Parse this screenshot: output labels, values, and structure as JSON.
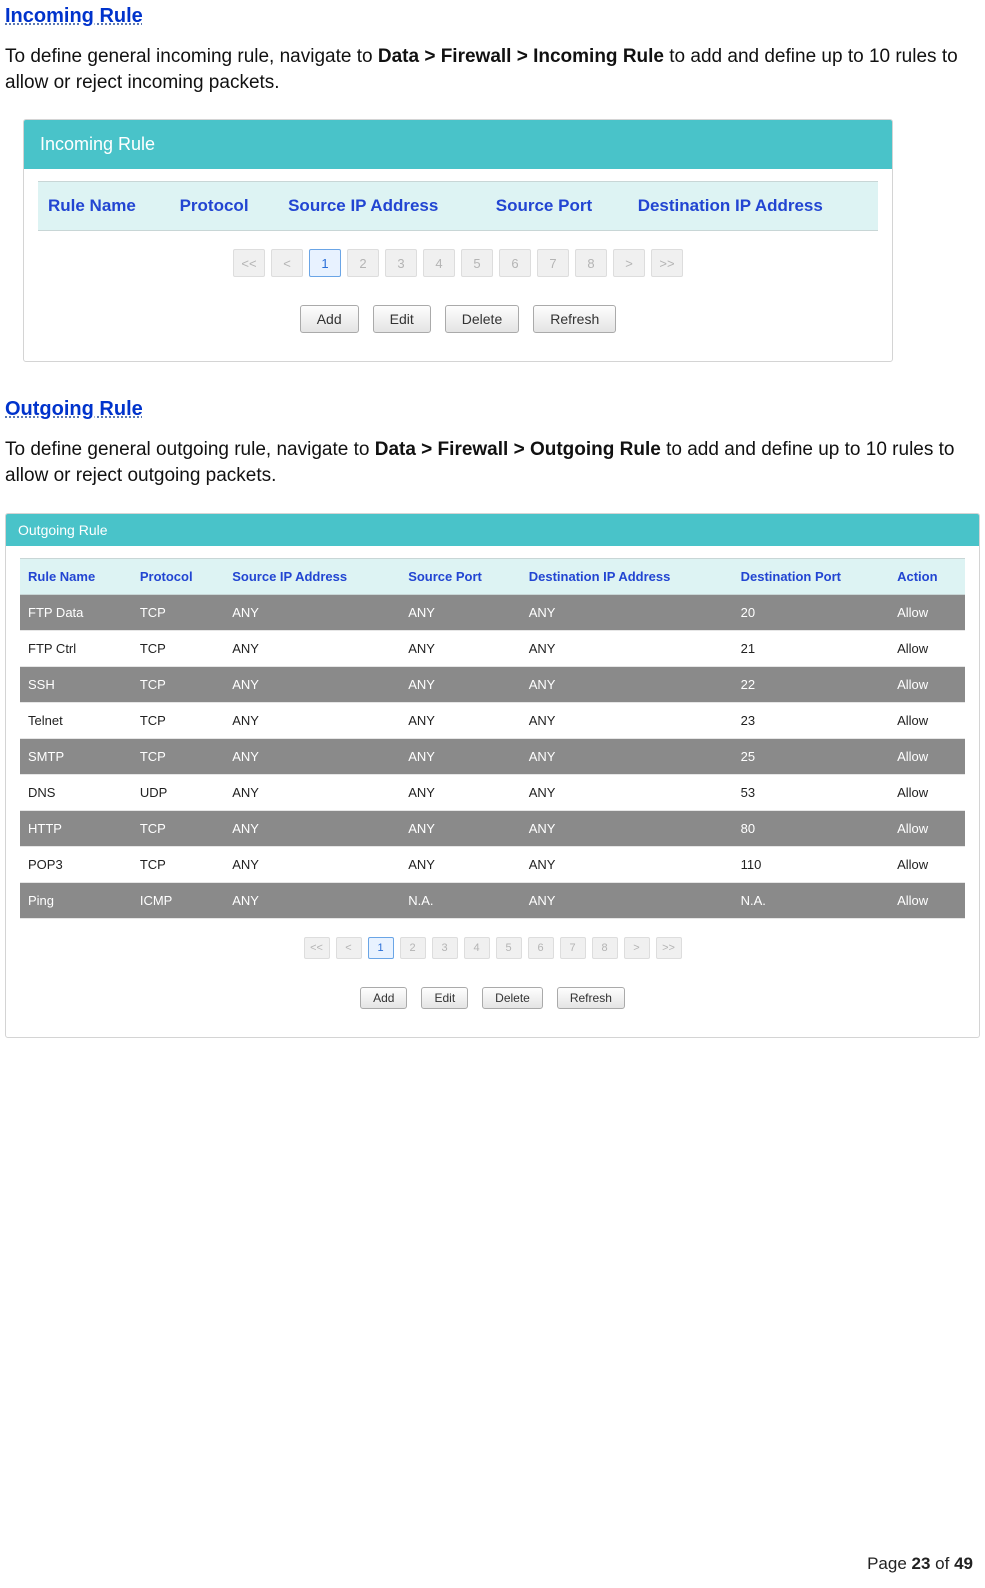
{
  "sections": {
    "incoming": {
      "heading": "Incoming Rule",
      "desc_pre": "To define general incoming rule, navigate to ",
      "desc_bold": "Data > Firewall > Incoming Rule",
      "desc_post": " to add and define up to 10 rules to allow or reject incoming packets.",
      "panel_title": "Incoming Rule",
      "columns": [
        "Rule Name",
        "Protocol",
        "Source IP Address",
        "Source Port",
        "Destination IP Address"
      ]
    },
    "outgoing": {
      "heading": "Outgoing Rule",
      "desc_pre": "To define general outgoing rule, navigate to ",
      "desc_bold": "Data > Firewall > Outgoing Rule",
      "desc_post": " to add and define up to 10 rules to allow or reject outgoing packets.",
      "panel_title": "Outgoing Rule",
      "columns": [
        "Rule Name",
        "Protocol",
        "Source IP Address",
        "Source Port",
        "Destination IP Address",
        "Destination Port",
        "Action"
      ],
      "rows": [
        {
          "name": "FTP Data",
          "proto": "TCP",
          "src_ip": "ANY",
          "src_port": "ANY",
          "dst_ip": "ANY",
          "dst_port": "20",
          "action": "Allow"
        },
        {
          "name": "FTP Ctrl",
          "proto": "TCP",
          "src_ip": "ANY",
          "src_port": "ANY",
          "dst_ip": "ANY",
          "dst_port": "21",
          "action": "Allow"
        },
        {
          "name": "SSH",
          "proto": "TCP",
          "src_ip": "ANY",
          "src_port": "ANY",
          "dst_ip": "ANY",
          "dst_port": "22",
          "action": "Allow"
        },
        {
          "name": "Telnet",
          "proto": "TCP",
          "src_ip": "ANY",
          "src_port": "ANY",
          "dst_ip": "ANY",
          "dst_port": "23",
          "action": "Allow"
        },
        {
          "name": "SMTP",
          "proto": "TCP",
          "src_ip": "ANY",
          "src_port": "ANY",
          "dst_ip": "ANY",
          "dst_port": "25",
          "action": "Allow"
        },
        {
          "name": "DNS",
          "proto": "UDP",
          "src_ip": "ANY",
          "src_port": "ANY",
          "dst_ip": "ANY",
          "dst_port": "53",
          "action": "Allow"
        },
        {
          "name": "HTTP",
          "proto": "TCP",
          "src_ip": "ANY",
          "src_port": "ANY",
          "dst_ip": "ANY",
          "dst_port": "80",
          "action": "Allow"
        },
        {
          "name": "POP3",
          "proto": "TCP",
          "src_ip": "ANY",
          "src_port": "ANY",
          "dst_ip": "ANY",
          "dst_port": "110",
          "action": "Allow"
        },
        {
          "name": "Ping",
          "proto": "ICMP",
          "src_ip": "ANY",
          "src_port": "N.A.",
          "dst_ip": "ANY",
          "dst_port": "N.A.",
          "action": "Allow"
        }
      ]
    }
  },
  "pager": {
    "first": "<<",
    "prev": "<",
    "pages": [
      "1",
      "2",
      "3",
      "4",
      "5",
      "6",
      "7",
      "8"
    ],
    "active": "1",
    "next": ">",
    "last": ">>"
  },
  "buttons": {
    "add": "Add",
    "edit": "Edit",
    "delete": "Delete",
    "refresh": "Refresh"
  },
  "footer": {
    "pre": "Page ",
    "current": "23",
    "mid": " of ",
    "total": "49"
  }
}
